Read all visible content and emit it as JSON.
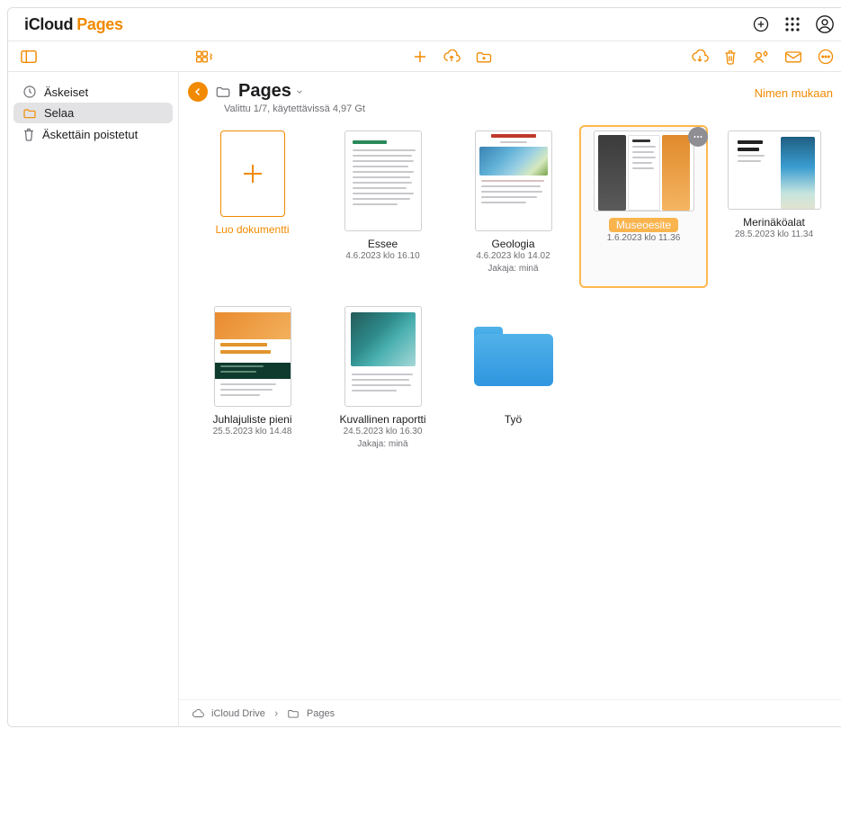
{
  "brand": {
    "icloud": "iCloud",
    "app": "Pages"
  },
  "topbar_icons": {
    "add": "add-button",
    "apps": "apps-grid",
    "account": "account-avatar"
  },
  "sidebar": {
    "items": [
      {
        "id": "recents",
        "label": "Äskeiset",
        "icon": "clock-icon"
      },
      {
        "id": "browse",
        "label": "Selaa",
        "icon": "folder-icon",
        "selected": true
      },
      {
        "id": "trash",
        "label": "Äskettäin poistetut",
        "icon": "trash-icon"
      }
    ]
  },
  "location": {
    "title": "Pages",
    "subtitle": "Valittu 1/7, käytettävissä 4,97 Gt"
  },
  "sort_label": "Nimen mukaan",
  "create_label": "Luo dokumentti",
  "docs": [
    {
      "id": "essee",
      "name": "Essee",
      "meta": "4.6.2023 klo 16.10",
      "kind": "essay"
    },
    {
      "id": "geologia",
      "name": "Geologia",
      "meta": "4.6.2023 klo 14.02",
      "meta2": "Jakaja: minä",
      "kind": "geology"
    },
    {
      "id": "museoesite",
      "name": "Museoesite",
      "meta": "1.6.2023 klo 11.36",
      "kind": "tri",
      "selected": true
    },
    {
      "id": "merinakoalat",
      "name": "Merinäköalat",
      "meta": "28.5.2023 klo 11.34",
      "kind": "beach"
    },
    {
      "id": "juhlajuliste",
      "name": "Juhlajuliste pieni",
      "meta": "25.5.2023 klo 14.48",
      "kind": "party"
    },
    {
      "id": "kuvallinen",
      "name": "Kuvallinen raportti",
      "meta": "24.5.2023 klo 16.30",
      "meta2": "Jakaja: minä",
      "kind": "photo"
    }
  ],
  "folders": [
    {
      "id": "tyo",
      "name": "Työ"
    }
  ],
  "path": {
    "root": "iCloud Drive",
    "leaf": "Pages"
  }
}
